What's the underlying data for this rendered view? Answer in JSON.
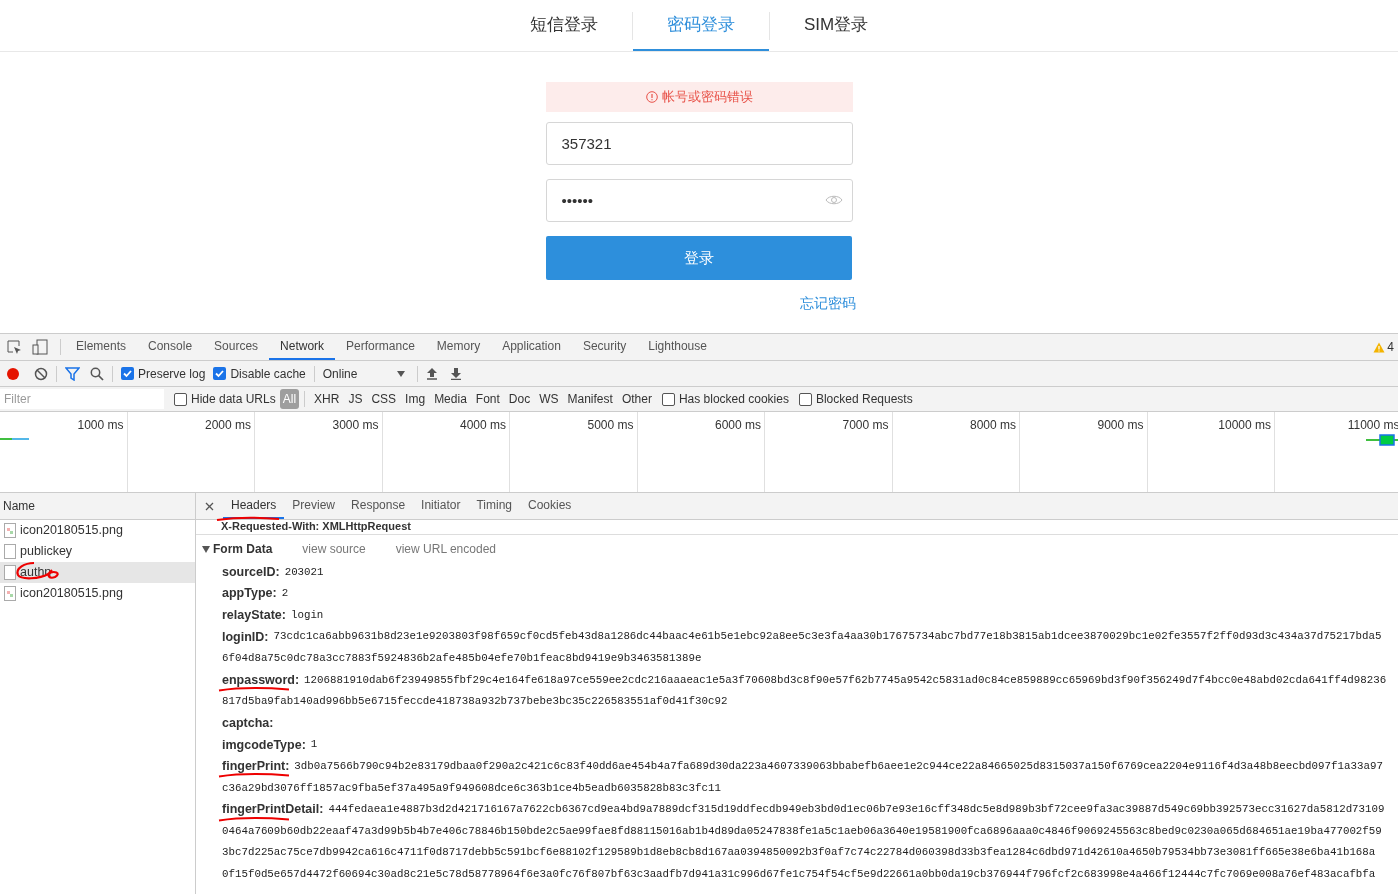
{
  "login": {
    "tabs": [
      {
        "label": "短信登录",
        "selected": false
      },
      {
        "label": "密码登录",
        "selected": true
      },
      {
        "label": "SIM登录",
        "selected": false
      }
    ],
    "error": "帐号或密码错误",
    "username": "357321",
    "password": "••••••",
    "submit": "登录",
    "forgot": "忘记密码"
  },
  "devtools": {
    "tabs": [
      {
        "label": "Elements",
        "selected": false
      },
      {
        "label": "Console",
        "selected": false
      },
      {
        "label": "Sources",
        "selected": false
      },
      {
        "label": "Network",
        "selected": true
      },
      {
        "label": "Performance",
        "selected": false
      },
      {
        "label": "Memory",
        "selected": false
      },
      {
        "label": "Application",
        "selected": false
      },
      {
        "label": "Security",
        "selected": false
      },
      {
        "label": "Lighthouse",
        "selected": false
      }
    ],
    "warnings": "4",
    "toolbar": {
      "preserve_log": {
        "label": "Preserve log",
        "checked": true
      },
      "disable_cache": {
        "label": "Disable cache",
        "checked": true
      },
      "throttling": "Online"
    },
    "filter": {
      "placeholder": "Filter",
      "hide_data_urls": {
        "label": "Hide data URLs",
        "checked": false
      },
      "types": [
        {
          "label": "All",
          "selected": true
        },
        {
          "label": "XHR",
          "selected": false
        },
        {
          "label": "JS",
          "selected": false
        },
        {
          "label": "CSS",
          "selected": false
        },
        {
          "label": "Img",
          "selected": false
        },
        {
          "label": "Media",
          "selected": false
        },
        {
          "label": "Font",
          "selected": false
        },
        {
          "label": "Doc",
          "selected": false
        },
        {
          "label": "WS",
          "selected": false
        },
        {
          "label": "Manifest",
          "selected": false
        },
        {
          "label": "Other",
          "selected": false
        }
      ],
      "has_blocked_cookies": {
        "label": "Has blocked cookies",
        "checked": false
      },
      "blocked_requests": {
        "label": "Blocked Requests",
        "checked": false
      }
    },
    "timeline": [
      "1000 ms",
      "2000 ms",
      "3000 ms",
      "4000 ms",
      "5000 ms",
      "6000 ms",
      "7000 ms",
      "8000 ms",
      "9000 ms",
      "10000 ms",
      "11000 ms"
    ],
    "requests": {
      "header": "Name",
      "rows": [
        {
          "name": "icon20180515.png",
          "kind": "image",
          "selected": false
        },
        {
          "name": "publickey",
          "kind": "document",
          "selected": false
        },
        {
          "name": "authn",
          "kind": "document",
          "selected": true
        },
        {
          "name": "icon20180515.png",
          "kind": "image",
          "selected": false
        }
      ]
    },
    "detail_tabs": [
      {
        "label": "Headers",
        "selected": true
      },
      {
        "label": "Preview",
        "selected": false
      },
      {
        "label": "Response",
        "selected": false
      },
      {
        "label": "Initiator",
        "selected": false
      },
      {
        "label": "Timing",
        "selected": false
      },
      {
        "label": "Cookies",
        "selected": false
      }
    ],
    "cut_header": "X-Requested-With: XMLHttpRequest",
    "form_data": {
      "title": "Form Data",
      "expanded": true,
      "links": [
        "view source",
        "view URL encoded"
      ],
      "fields": [
        {
          "key": "sourceID:",
          "lines": [
            "203021"
          ],
          "underlined": false
        },
        {
          "key": "appType:",
          "lines": [
            "2"
          ],
          "underlined": false
        },
        {
          "key": "relayState:",
          "lines": [
            "login"
          ],
          "underlined": false
        },
        {
          "key": "loginID:",
          "lines": [
            "73cdc1ca6abb9631b8d23e1e9203803f98f659cf0cd5feb43d8a1286dc44baac4e61b5e1ebc92a8ee5c3e3fa4aa30b17675734abc7bd77e18b3815ab1dcee3870029bc1e02fe3557f2ff0d93d3c434a37d75217bda5",
            "6f04d8a75c0dc78a3cc7883f5924836b2afe485b04efe70b1feac8bd9419e9b3463581389e"
          ],
          "underlined": false
        },
        {
          "key": "enpassword:",
          "lines": [
            "1206881910dab6f23949855fbf29c4e164fe618a97ce559ee2cdc216aaaeac1e5a3f70608bd3c8f90e57f62b7745a9542c5831ad0c84ce859889cc65969bd3f90f356249d7f4bcc0e48abd02cda641ff4d98236",
            "817d5ba9fab140ad996bb5e6715feccde418738a932b737bebe3bc35c226583551af0d41f30c92"
          ],
          "underlined": true
        },
        {
          "key": "captcha:",
          "underlined": false
        },
        {
          "key": "imgcodeType:",
          "lines": [
            "1"
          ],
          "underlined": false
        },
        {
          "key": "fingerPrint:",
          "lines": [
            "3db0a7566b790c94b2e83179dbaa0f290a2c421c6c83f40dd6ae454b4a7fa689d30da223a4607339063bbabefb6aee1e2c944ce22a84665025d8315037a150f6769cea2204e9116f4d3a48b8eecbd097f1a33a97",
            "c36a29bd3076ff1857ac9fba5ef37a495a9f949608dce6c363b1ce4b5eadb6035828b83c3fc11"
          ],
          "underlined": true
        },
        {
          "key": "fingerPrintDetail:",
          "lines": [
            "444fedaea1e4887b3d2d421716167a7622cb6367cd9ea4bd9a7889dcf315d19ddfecdb949eb3bd0d1ec06b7e93e16cff348dc5e8d989b3bf72cee9fa3ac39887d549c69bb392573ecc31627da5812d73109",
            "0464a7609b60db22eaaf47a3d99b5b4b7e406c78846b150bde2c5ae99fae8fd88115016ab1b4d89da05247838fe1a5c1aeb06a3640e19581900fca6896aaa0c4846f9069245563c8bed9c0230a065d684651ae19ba477002f59",
            "3bc7d225ac75ce7db9942ca616c4711f0d8717debb5c591bcf6e88102f129589b1d8eb8cb8d167aa0394850092b3f0af7c74c22784d060398d33b3fea1284c6dbd971d42610a4650b79534bb73e3081ff665e38e6ba41b168a",
            "0f15f0d5e657d4472f60694c30ad8c21e5c78d58778964f6e3a0fc76f807bf63c3aadfb7d941a31c996d67fe1c754f54cf5e9d22661a0bb0da19cb376944f796fcf2c683998e4a466f12444c7fc7069e008a76ef483acafbfa"
          ],
          "underlined": true
        }
      ]
    }
  }
}
